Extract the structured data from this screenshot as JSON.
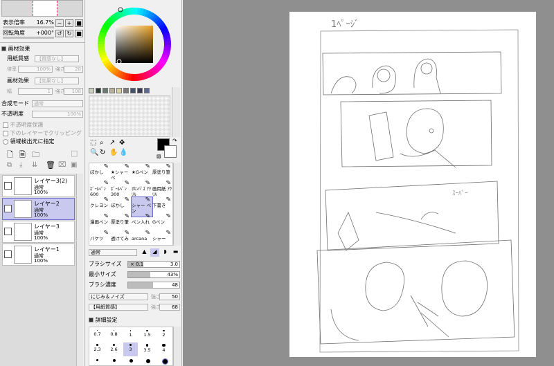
{
  "navigator": {
    "zoom_label": "表示倍率",
    "zoom_value": "16.7%",
    "angle_label": "回転角度",
    "angle_value": "+000°",
    "minus": "−",
    "plus": "+",
    "reset": "■"
  },
  "paper_effect": {
    "section_title": "画材効果",
    "texture_label": "用紙質感",
    "texture_value": "【質感なし】",
    "scale_label": "倍率",
    "scale_value": "100%",
    "strength_label": "強さ",
    "strength_value": "20",
    "effect_label": "画材効果",
    "effect_value": "【効果なし】",
    "width_label": "幅",
    "width_value": "1",
    "effect_strength_label": "強さ",
    "effect_strength_value": "100"
  },
  "blend": {
    "mode_label": "合成モード",
    "mode_value": "通常",
    "opacity_label": "不透明度",
    "opacity_value": "100%",
    "protect_label": "不透明度保護",
    "clip_label": "下のレイヤーでクリッピング",
    "selection_source_label": "領域検出元に指定"
  },
  "layers": [
    {
      "name": "レイヤー3(2)",
      "mode": "通常",
      "opacity": "100%",
      "selected": false
    },
    {
      "name": "レイヤー2",
      "mode": "通常",
      "opacity": "100%",
      "selected": true
    },
    {
      "name": "レイヤー3",
      "mode": "通常",
      "opacity": "100%",
      "selected": false
    },
    {
      "name": "レイヤー1",
      "mode": "通常",
      "opacity": "100%",
      "selected": false
    }
  ],
  "palette": {
    "swatches": [
      "#c8d0c0",
      "#2e3a35",
      "#6a7a70",
      "#b8b098",
      "#d8cfa0",
      "#7a7a7a",
      "#45506a",
      "#3a3a55",
      "#5a6a90"
    ]
  },
  "tool_glyphs": [
    "⬚",
    "⌕",
    "↗",
    "✥",
    "🔍",
    "↻",
    "✋",
    "💧"
  ],
  "brushes": [
    {
      "label": "ぼかし"
    },
    {
      "label": "★シャーペ"
    },
    {
      "label": "★Gペン"
    },
    {
      "label": "厚塗り筆"
    },
    {
      "label": "ﾎﾞｰﾙﾍﾟﾝ 600"
    },
    {
      "label": "ﾎﾞｰﾙﾍﾟﾝ 300"
    },
    {
      "label": "ｵｷﾝﾊﾟｽ ｱｸﾘﾙ"
    },
    {
      "label": "画用紙 ｱｸﾘﾙ"
    },
    {
      "label": "クレヨン"
    },
    {
      "label": "ぼかし"
    },
    {
      "label": "シャー ペン"
    },
    {
      "label": "下書き"
    },
    {
      "label": "漫画ペン"
    },
    {
      "label": "厚塗り筆"
    },
    {
      "label": "ペン入れ"
    },
    {
      "label": "Gペン"
    },
    {
      "label": "バケツ"
    },
    {
      "label": "透けてみ"
    },
    {
      "label": "arcana"
    },
    {
      "label": "シャー"
    }
  ],
  "brush_settings": {
    "mode_value": "通常",
    "size_label": "ブラシサイズ",
    "size_mult": "× 0.1",
    "size_value": "3.0",
    "min_size_label": "最小サイズ",
    "min_size_value": "43%",
    "min_size_fraction": 0.43,
    "density_label": "ブラシ濃度",
    "density_value": "48",
    "density_fraction": 0.48,
    "blur_value": "にじみ＆ノイズ",
    "blur_strength_label": "強さ",
    "blur_strength_value": "50",
    "texture_value": "【用紙質感】",
    "texture_strength_label": "強さ",
    "texture_strength_value": "68",
    "advanced_label": "詳細設定"
  },
  "size_presets": [
    "0.7",
    "0.8",
    "1",
    "1.5",
    "2",
    "2.3",
    "2.6",
    "3",
    "3.5",
    "4"
  ],
  "canvas": {
    "annotation": "1ﾍﾟｰｼﾞ"
  }
}
